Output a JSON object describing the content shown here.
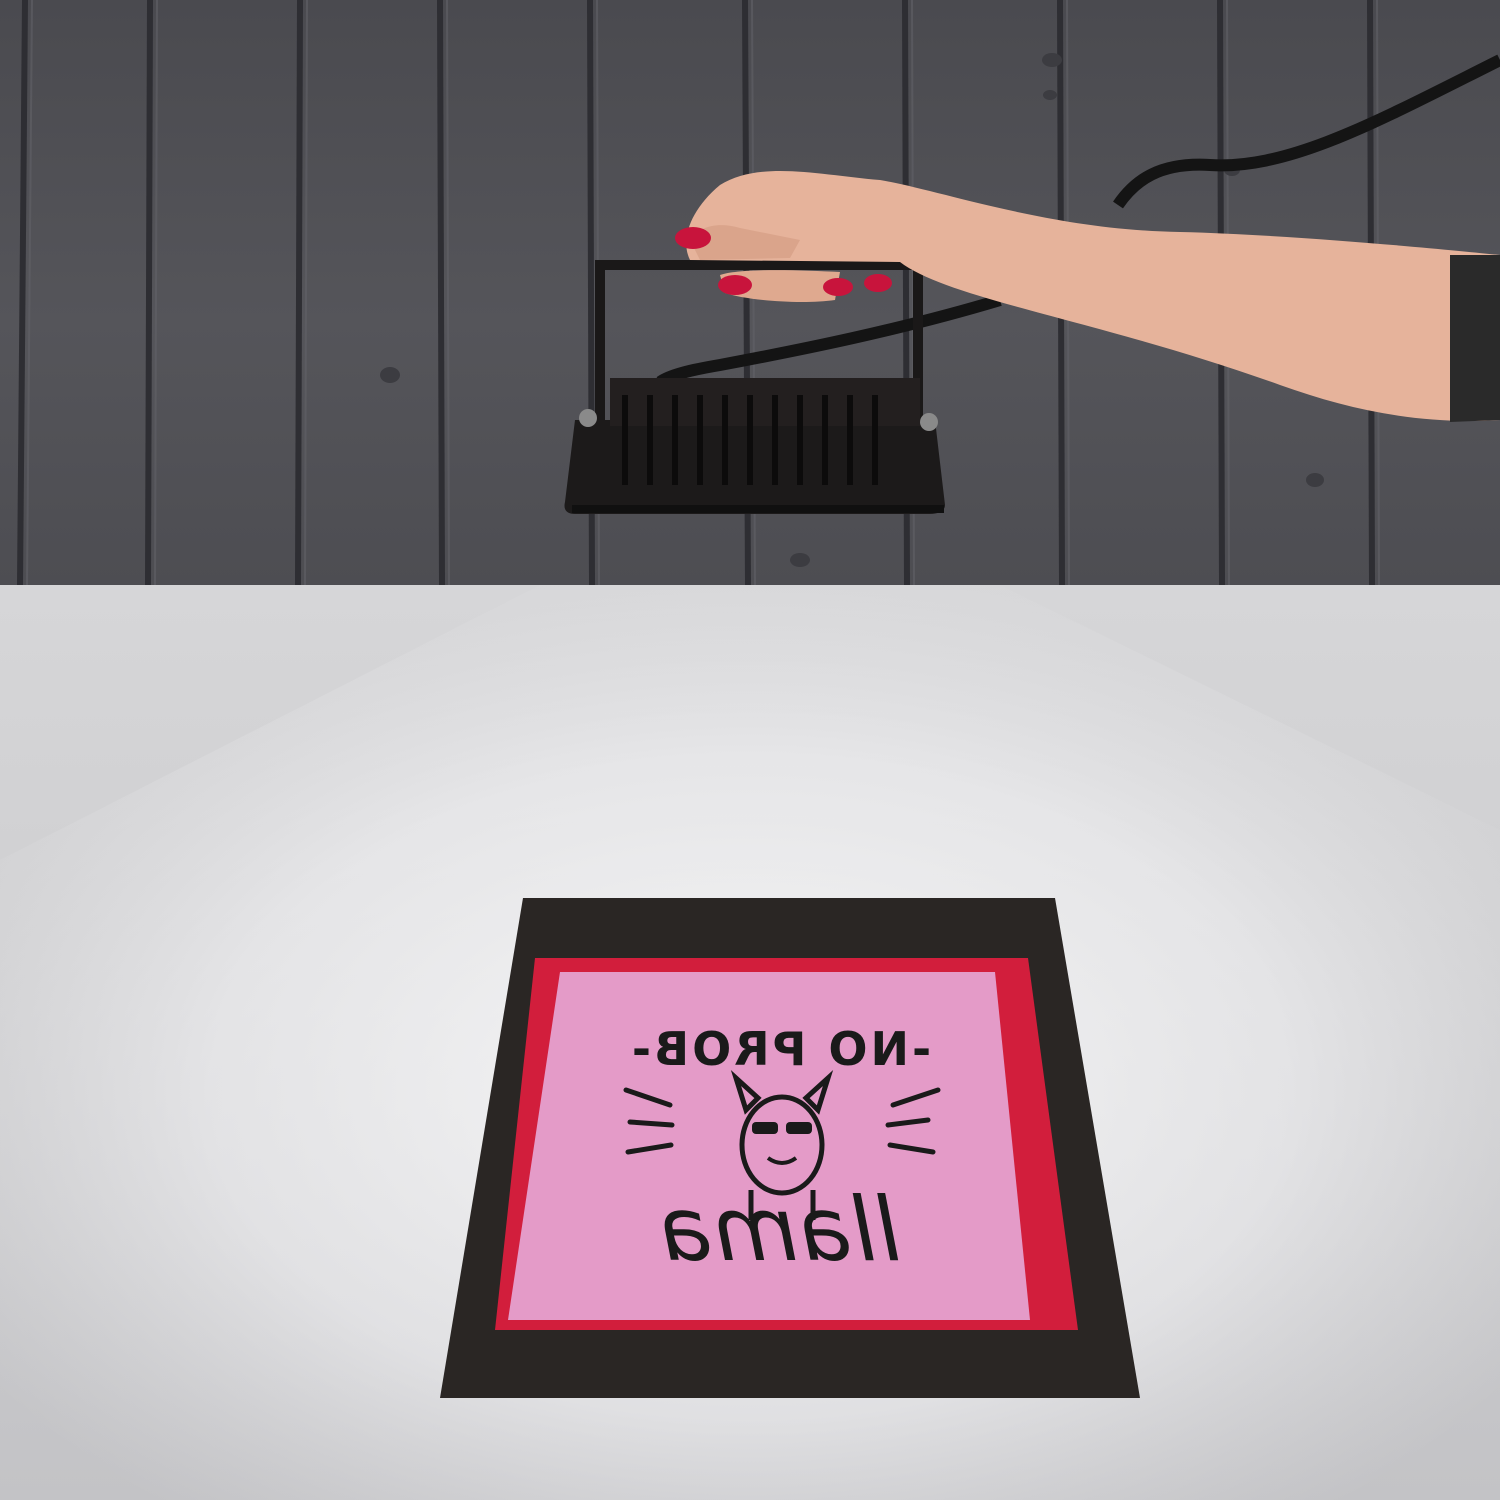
{
  "artwork": {
    "headline": "-NO PROB-",
    "script_word": "llama"
  },
  "colors": {
    "wall": "#505055",
    "table": "#d4d4d6",
    "lamp_body": "#1c1a1a",
    "skin": "#e8b49a",
    "nail_polish": "#c8143c",
    "exposure_frame": "#2a2624",
    "red_film": "#d21e3c",
    "pink_screen": "#e49bc8",
    "ink": "#1a1a1a"
  },
  "icons": [
    "uv-lamp-icon",
    "hand-icon",
    "llama-icon"
  ]
}
